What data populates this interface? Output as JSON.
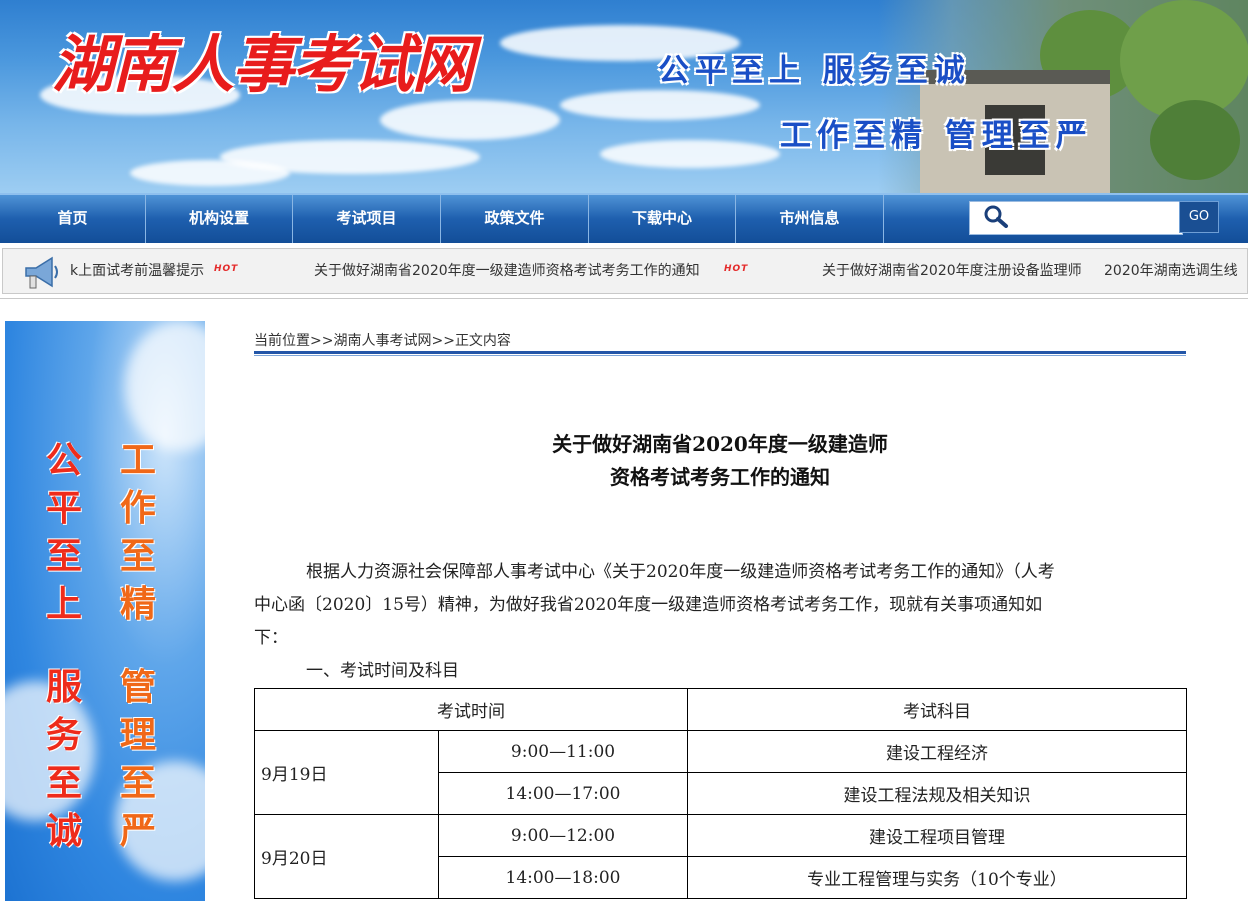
{
  "header": {
    "site_title": "湖南人事考试网",
    "slogan_line1": "公平至上  服务至诚",
    "slogan_line2": "工作至精  管理至严"
  },
  "nav": {
    "items": [
      "首页",
      "机构设置",
      "考试项目",
      "政策文件",
      "下载中心",
      "市州信息"
    ],
    "search_placeholder": "",
    "go_label": "GO"
  },
  "ticker": {
    "items": [
      {
        "text": "k上面试考前温馨提示",
        "hot": "HOT"
      },
      {
        "text": "关于做好湖南省2020年度一级建造师资格考试考务工作的通知",
        "hot": "HOT"
      },
      {
        "text": "关于做好湖南省2020年度注册设备监理师",
        "hot": ""
      },
      {
        "text": "2020年湖南选调生线",
        "hot": ""
      }
    ]
  },
  "side_panel": {
    "col1_top": [
      "公",
      "平",
      "至",
      "上"
    ],
    "col2_top": [
      "工",
      "作",
      "至",
      "精"
    ],
    "col1_bottom": [
      "服",
      "务",
      "至",
      "诚"
    ],
    "col2_bottom": [
      "管",
      "理",
      "至",
      "严"
    ]
  },
  "breadcrumb": {
    "label": "当前位置",
    "sep": ">>",
    "home": "湖南人事考试网",
    "current": "正文内容"
  },
  "article": {
    "title_line1": "关于做好湖南省2020年度一级建造师",
    "title_line2": "资格考试考务工作的通知",
    "para1_line1": "根据人力资源社会保障部人事考试中心《关于2020年度一级建造师资格考试考务工作的通知》（人考",
    "para1_line2": "中心函〔2020〕15号）精神，为做好我省2020年度一级建造师资格考试考务工作，现就有关事项通知如",
    "para1_line3": "下：",
    "section1": "一、考试时间及科目"
  },
  "exam_table": {
    "header_time": "考试时间",
    "header_subject": "考试科目",
    "days": [
      {
        "date": "9月19日",
        "sessions": [
          {
            "time": "9:00—11:00",
            "subject": "建设工程经济"
          },
          {
            "time": "14:00—17:00",
            "subject": "建设工程法规及相关知识"
          }
        ]
      },
      {
        "date": "9月20日",
        "sessions": [
          {
            "time": "9:00—12:00",
            "subject": "建设工程项目管理"
          },
          {
            "time": "14:00—18:00",
            "subject": "专业工程管理与实务（10个专业）"
          }
        ]
      }
    ]
  }
}
